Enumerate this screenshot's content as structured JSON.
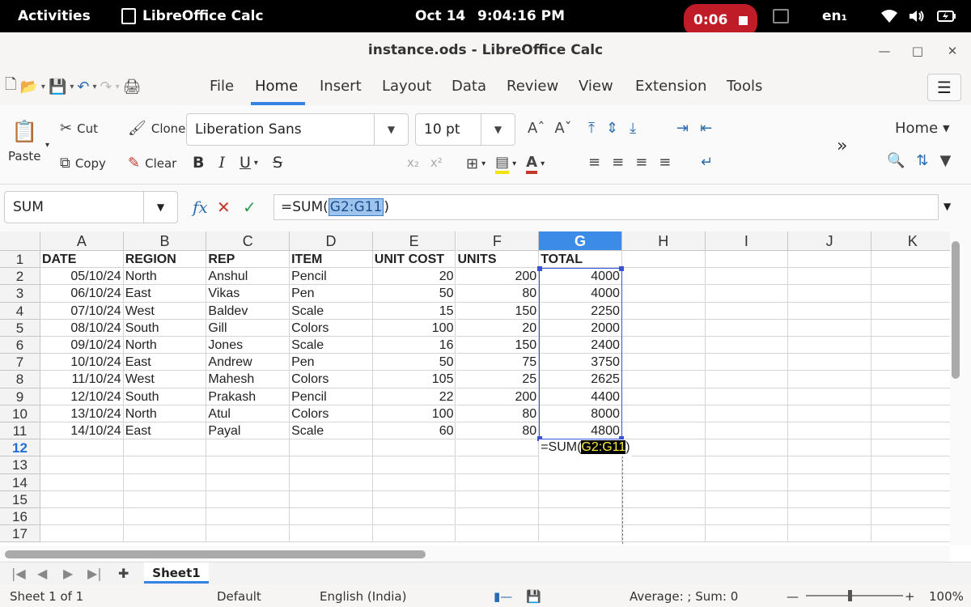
{
  "topbar": {
    "activities": "Activities",
    "app_name": "LibreOffice Calc",
    "date": "Oct 14",
    "time": "9:04:16 PM",
    "recording": "0:06",
    "lang": "en₁"
  },
  "window": {
    "title": "instance.ods - LibreOffice Calc"
  },
  "tabs": [
    "File",
    "Home",
    "Insert",
    "Layout",
    "Data",
    "Review",
    "View",
    "Extension",
    "Tools"
  ],
  "active_tab": "Home",
  "ribbon": {
    "paste": "Paste",
    "cut": "Cut",
    "copy": "Copy",
    "clone": "Clone",
    "clear": "Clear",
    "font_name": "Liberation Sans",
    "font_size": "10 pt",
    "style_menu": "Home"
  },
  "formula_bar": {
    "name_box": "SUM",
    "formula_prefix": "=SUM(",
    "formula_ref": "G2:G11",
    "formula_suffix": ")"
  },
  "columns": [
    "A",
    "B",
    "C",
    "D",
    "E",
    "F",
    "G",
    "H",
    "I",
    "J",
    "K"
  ],
  "selected_column": "G",
  "selected_row": "12",
  "rows": [
    "1",
    "2",
    "3",
    "4",
    "5",
    "6",
    "7",
    "8",
    "9",
    "10",
    "11",
    "12",
    "13",
    "14",
    "15",
    "16",
    "17"
  ],
  "headers": [
    "DATE",
    "REGION",
    "REP",
    "ITEM",
    "UNIT COST",
    "UNITS",
    "TOTAL"
  ],
  "data": [
    [
      "05/10/24",
      "North",
      "Anshul",
      "Pencil",
      "20",
      "200",
      "4000"
    ],
    [
      "06/10/24",
      "East",
      "Vikas",
      "Pen",
      "50",
      "80",
      "4000"
    ],
    [
      "07/10/24",
      "West",
      "Baldev",
      "Scale",
      "15",
      "150",
      "2250"
    ],
    [
      "08/10/24",
      "South",
      "Gill",
      "Colors",
      "100",
      "20",
      "2000"
    ],
    [
      "09/10/24",
      "North",
      "Jones",
      "Scale",
      "16",
      "150",
      "2400"
    ],
    [
      "10/10/24",
      "East",
      "Andrew",
      "Pen",
      "50",
      "75",
      "3750"
    ],
    [
      "11/10/24",
      "West",
      "Mahesh",
      "Colors",
      "105",
      "25",
      "2625"
    ],
    [
      "12/10/24",
      "South",
      "Prakash",
      "Pencil",
      "22",
      "200",
      "4400"
    ],
    [
      "13/10/24",
      "North",
      "Atul",
      "Colors",
      "100",
      "80",
      "8000"
    ],
    [
      "14/10/24",
      "East",
      "Payal",
      "Scale",
      "60",
      "80",
      "4800"
    ]
  ],
  "edit_cell": {
    "prefix": "=SUM(",
    "ref": "G2:G11",
    "suffix": ")"
  },
  "sheet_tab": "Sheet1",
  "status": {
    "sheet": "Sheet 1 of 1",
    "style": "Default",
    "language": "English (India)",
    "summary": "Average: ; Sum: 0",
    "zoom": "100%"
  },
  "colors": {
    "accent": "#3584e4",
    "selection": "#3a52d9",
    "record": "#c01c28"
  }
}
